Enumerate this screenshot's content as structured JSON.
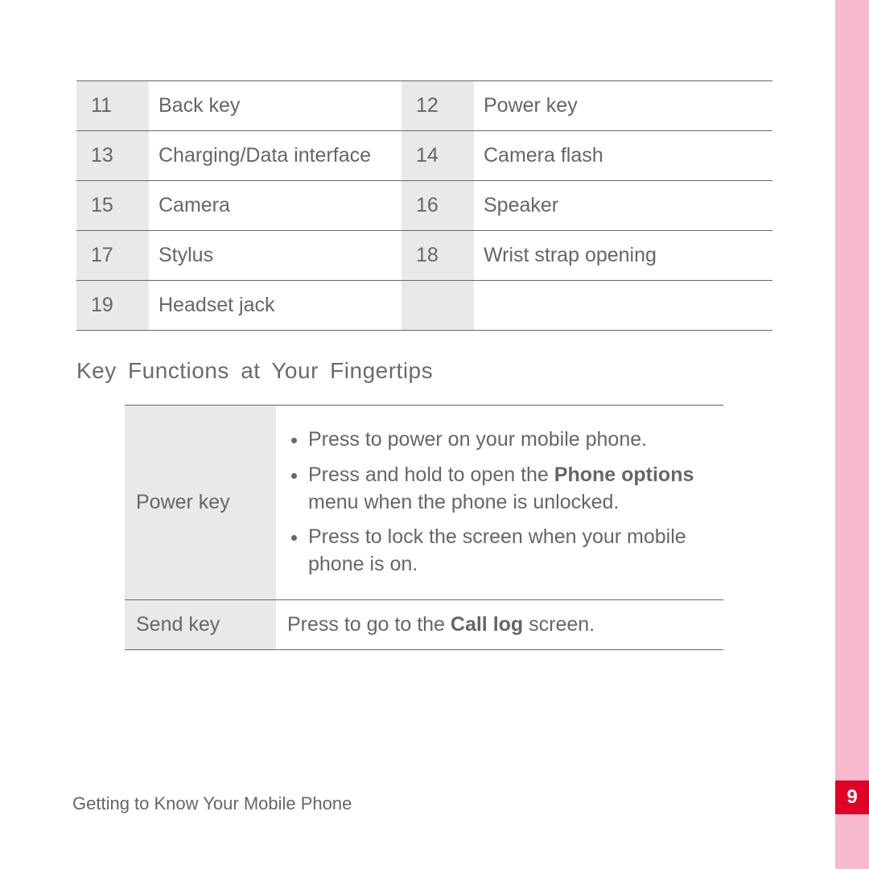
{
  "parts_table": [
    {
      "n1": "11",
      "l1": "Back key",
      "n2": "12",
      "l2": "Power key"
    },
    {
      "n1": "13",
      "l1": "Charging/Data interface",
      "n2": "14",
      "l2": "Camera flash"
    },
    {
      "n1": "15",
      "l1": "Camera",
      "n2": "16",
      "l2": "Speaker"
    },
    {
      "n1": "17",
      "l1": "Stylus",
      "n2": "18",
      "l2": "Wrist strap opening"
    },
    {
      "n1": "19",
      "l1": "Headset jack",
      "n2": "",
      "l2": ""
    }
  ],
  "section_title": "Key Functions at Your Fingertips",
  "functions": {
    "power_key_label": "Power key",
    "power_key_bullet1": "Press to power on your mobile phone.",
    "power_key_bullet2_pre": "Press and hold to open the ",
    "power_key_bullet2_bold": "Phone options",
    "power_key_bullet2_post": " menu when the phone is unlocked.",
    "power_key_bullet3": "Press to lock the screen when your mobile phone is on.",
    "send_key_label": "Send key",
    "send_key_pre": "Press to go to the ",
    "send_key_bold": "Call log",
    "send_key_post": " screen."
  },
  "footer": "Getting to Know Your Mobile Phone",
  "page_number": "9"
}
